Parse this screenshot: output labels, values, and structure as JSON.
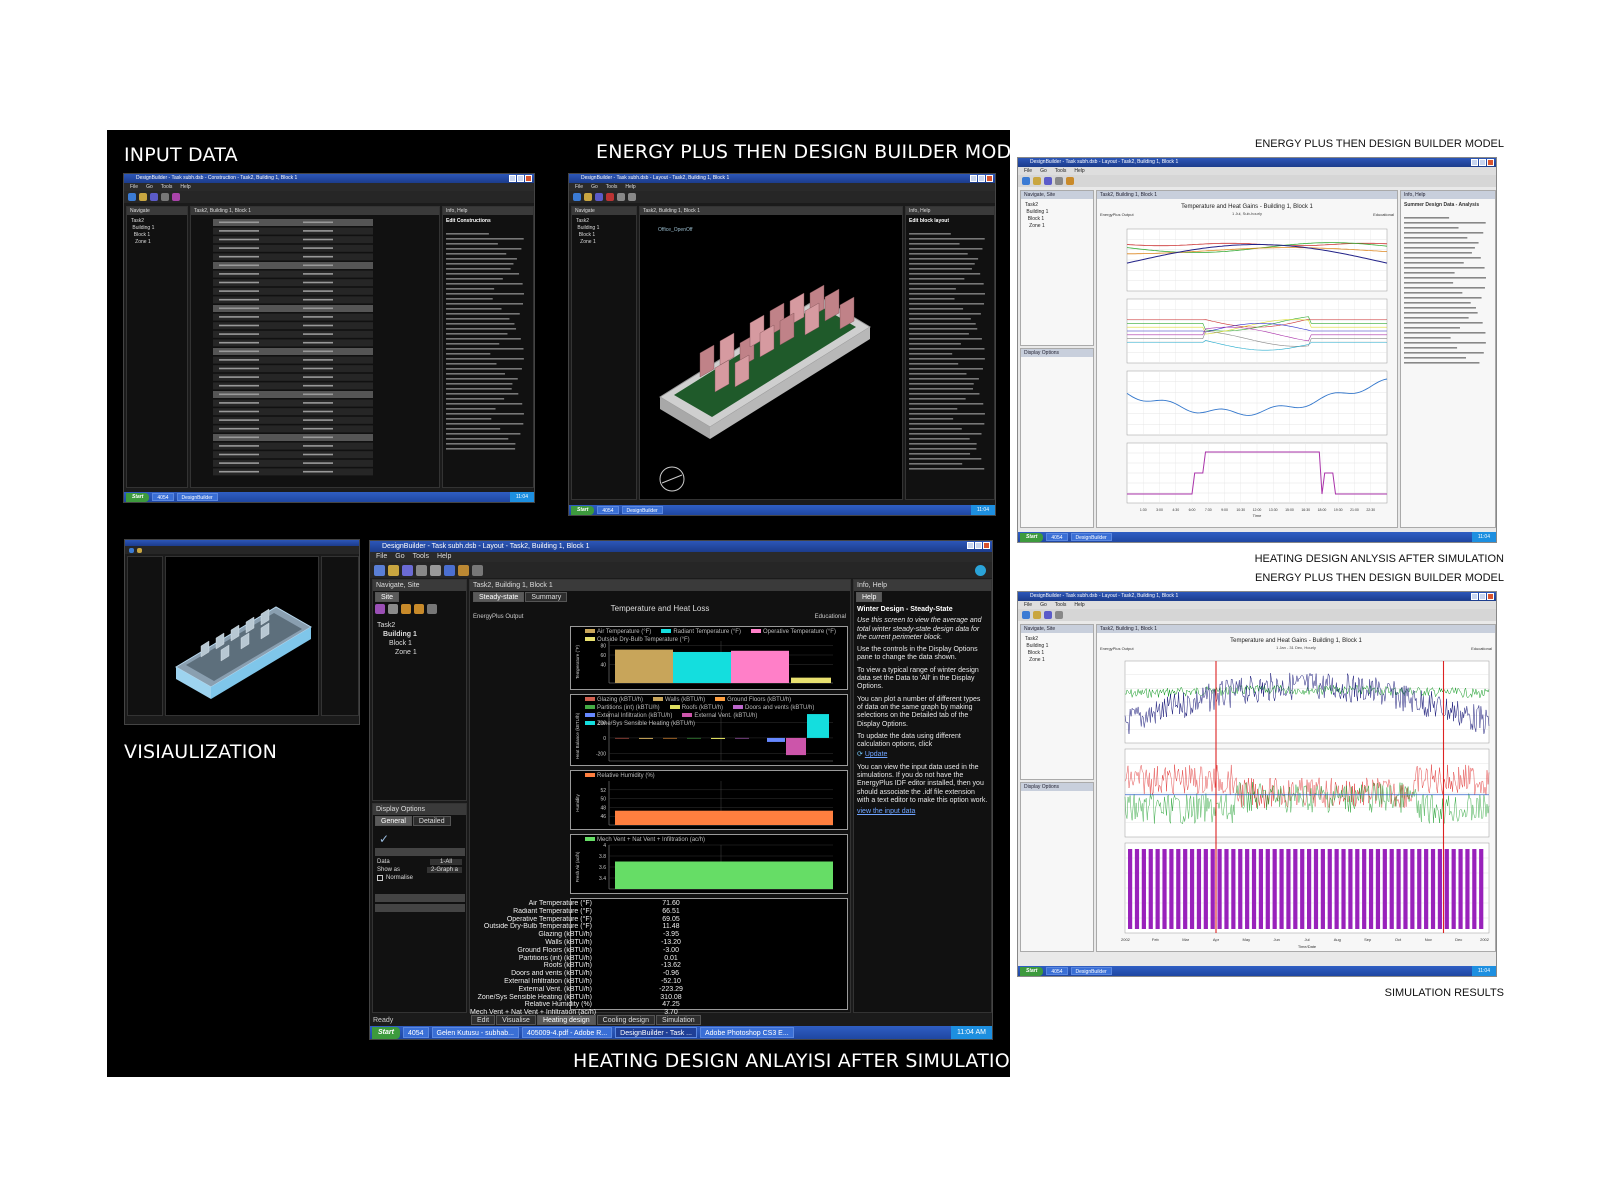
{
  "captions": {
    "input_data": "INPUT DATA",
    "energy_plus_main": "ENERGY PLUS THEN DESIGN BUILDER MODEL",
    "visualization": "VISIAULIZATION",
    "heating_design_main": "HEATING DESIGN ANLAYISI AFTER SIMULATION",
    "energy_plus_right_top": "ENERGY PLUS THEN DESIGN BUILDER MODEL",
    "heating_design_right": "HEATING DESIGN ANLYSIS AFTER SIMULATION",
    "energy_plus_right_mid": "ENERGY PLUS THEN DESIGN BUILDER MODEL",
    "simulation_results": "SIMULATION RESULTS"
  },
  "colors": {
    "panel_black": "#000000",
    "titlebar_blue": "#1c3c8c",
    "taskbar_blue": "#1f47a2",
    "start_green": "#3d9a3d",
    "bar_tan": "#c8a55a",
    "bar_cyan": "#14dede",
    "bar_pink": "#ff7fc8",
    "bar_orange": "#ff7f3f",
    "bar_green": "#66dd66",
    "series_green": "#119922",
    "series_navy": "#1a1a7a",
    "series_red": "#dd2222",
    "series_purple": "#9922bb"
  },
  "heating_window": {
    "title": "DesignBuilder - Task subh.dsb - Layout - Task2, Building 1, Block 1",
    "menu": [
      "File",
      "Go",
      "Tools",
      "Help"
    ],
    "nav_header": "Navigate, Site",
    "nav_tab": "Site",
    "tree": [
      "Task2",
      "Building 1",
      "Block 1",
      "Zone 1"
    ],
    "breadcrumb": "Task2, Building 1, Block 1",
    "tabs": [
      "Steady-state",
      "Summary"
    ],
    "info_header": "Info, Help",
    "info_tab": "Help",
    "chart_title": "Temperature and Heat Loss",
    "output_label": "EnergyPlus Output",
    "edu_label": "Educational",
    "display_options": "Display Options",
    "option_tabs": [
      "General",
      "Detailed"
    ],
    "option_data_label": "Data",
    "option_data_value": "1-All",
    "option_show_label": "Show as",
    "option_show_value": "2-Graph a",
    "option_normalise": "Normalise",
    "help_heading": "Winter Design - Steady-State",
    "help_paragraphs": [
      "Use this screen to view the average and total winter steady-state design data for the current perimeter block.",
      "Use the controls in the Display Options pane to change the data shown.",
      "To view a typical range of winter design data set the Data to 'All' in the Display Options.",
      "You can plot a number of different types of data on the same graph by making selections on the Detailed tab of the Display Options.",
      "To update the data using different calculation options, click",
      "You can view the input data used in the simulations. If you do not have the EnergyPlus IDF editor installed, then you should associate the .idf file extension with a text editor to make this option work."
    ],
    "help_link_update": "Update",
    "help_link_input": "view the input data",
    "bottom_tabs": [
      "Edit",
      "Visualise",
      "Heating design",
      "Cooling design",
      "Simulation"
    ],
    "status": "Ready",
    "taskbar": {
      "start": "Start",
      "items": [
        "4054",
        "Gelen Kutusu - subhab...",
        "405009-4.pdf - Adobe R...",
        "DesignBuilder - Task ...",
        "Adobe Photoshop CS3 E..."
      ],
      "clock": "11:04 AM"
    }
  },
  "summary_rows": [
    {
      "label": "Air Temperature (°F)",
      "value": "71.60"
    },
    {
      "label": "Radiant Temperature (°F)",
      "value": "66.51"
    },
    {
      "label": "Operative Temperature (°F)",
      "value": "69.05"
    },
    {
      "label": "Outside Dry-Bulb Temperature (°F)",
      "value": "11.48"
    },
    {
      "label": "Glazing (kBTU/h)",
      "value": "-3.95"
    },
    {
      "label": "Walls (kBTU/h)",
      "value": "-13.20"
    },
    {
      "label": "Ground Floors (kBTU/h)",
      "value": "-3.00"
    },
    {
      "label": "Partitions (int) (kBTU/h)",
      "value": "0.01"
    },
    {
      "label": "Roofs (kBTU/h)",
      "value": "-13.62"
    },
    {
      "label": "Doors and vents (kBTU/h)",
      "value": "-0.96"
    },
    {
      "label": "External Infiltration (kBTU/h)",
      "value": "-52.10"
    },
    {
      "label": "External Vent. (kBTU/h)",
      "value": "-223.29"
    },
    {
      "label": "Zone/Sys Sensible Heating (kBTU/h)",
      "value": "310.08"
    },
    {
      "label": "Relative Humidity (%)",
      "value": "47.25"
    },
    {
      "label": "Mech Vent + Nat Vent + Infiltration (ac/h)",
      "value": "3.70"
    }
  ],
  "input_window": {
    "title": "DesignBuilder - Task subh.dsb - Construction - Task2, Building 1, Block 1",
    "breadcrumb": "Task2, Building 1, Block 1",
    "info_header": "Info, Help",
    "help_heading": "Edit Constructions"
  },
  "model_window": {
    "title": "DesignBuilder - Task subh.dsb - Layout - Task2, Building 1, Block 1",
    "breadcrumb": "Task2, Building 1, Block 1",
    "help_heading": "Edit block layout",
    "label": "Office_OpenOff"
  },
  "right_top_window": {
    "title": "DesignBuilder - Task subh.dsb - Layout - Task2, Building 1, Block 1",
    "chart_title": "Temperature and Heat Gains - Building 1, Block 1",
    "chart_subtitle": "1 Jul, Sub-hourly",
    "output_label": "EnergyPlus Output",
    "edu_label": "Educational",
    "help_heading": "Summer Design Data - Analysis",
    "x_label": "Time",
    "x_ticks": [
      "1:30",
      "3:00",
      "4:30",
      "6:00",
      "7:30",
      "9:00",
      "10:30",
      "12:00",
      "13:30",
      "15:00",
      "16:30",
      "18:00",
      "19:30",
      "21:00",
      "22:30"
    ]
  },
  "right_bottom_window": {
    "title": "DesignBuilder - Task subh.dsb - Layout - Task2, Building 1, Block 1",
    "chart_title": "Temperature and Heat Gains - Building 1, Block 1",
    "chart_subtitle": "1 Jan - 31 Dec, Hourly",
    "output_label": "EnergyPlus Output",
    "edu_label": "Educational",
    "x_label": "Time/Date",
    "x_ticks": [
      "Feb",
      "Mar",
      "Apr",
      "May",
      "Jun",
      "Jul",
      "Aug",
      "Sep",
      "Oct",
      "Nov",
      "Dec"
    ],
    "year_left": "2002",
    "year_right": "2002"
  },
  "chart_data": [
    {
      "type": "bar",
      "title": "Temperature and Heat Loss",
      "ylabel": "Temperature (°F)",
      "ylim": [
        0,
        90
      ],
      "series": [
        {
          "name": "Air Temperature (°F)",
          "values": [
            71.6
          ]
        },
        {
          "name": "Radiant Temperature (°F)",
          "values": [
            66.51
          ]
        },
        {
          "name": "Operative Temperature (°F)",
          "values": [
            69.05
          ]
        },
        {
          "name": "Outside Dry-Bulb Temperature (°F)",
          "values": [
            11.48
          ]
        }
      ]
    },
    {
      "type": "bar",
      "ylabel": "Heat Balance (kBTU/h)",
      "ylim": [
        -300,
        350
      ],
      "series": [
        {
          "name": "Glazing (kBTU/h)",
          "values": [
            -3.95
          ]
        },
        {
          "name": "Walls (kBTU/h)",
          "values": [
            -13.2
          ]
        },
        {
          "name": "Ground Floors (kBTU/h)",
          "values": [
            -3.0
          ]
        },
        {
          "name": "Partitions (int) (kBTU/h)",
          "values": [
            0.01
          ]
        },
        {
          "name": "Roofs (kBTU/h)",
          "values": [
            -13.62
          ]
        },
        {
          "name": "Doors and vents (kBTU/h)",
          "values": [
            -0.96
          ]
        },
        {
          "name": "External Infiltration (kBTU/h)",
          "values": [
            -52.1
          ]
        },
        {
          "name": "External Vent. (kBTU/h)",
          "values": [
            -223.29
          ]
        },
        {
          "name": "Zone/Sys Sensible Heating (kBTU/h)",
          "values": [
            310.08
          ]
        }
      ]
    },
    {
      "type": "bar",
      "ylabel": "Humidity",
      "ylim": [
        44,
        54
      ],
      "series": [
        {
          "name": "Relative Humidity (%)",
          "values": [
            47.25
          ]
        }
      ]
    },
    {
      "type": "bar",
      "ylabel": "Fresh Air (ac/h)",
      "ylim": [
        3.2,
        4.0
      ],
      "series": [
        {
          "name": "Mech Vent + Nat Vent + Infiltration (ac/h)",
          "values": [
            3.7
          ]
        }
      ]
    }
  ]
}
